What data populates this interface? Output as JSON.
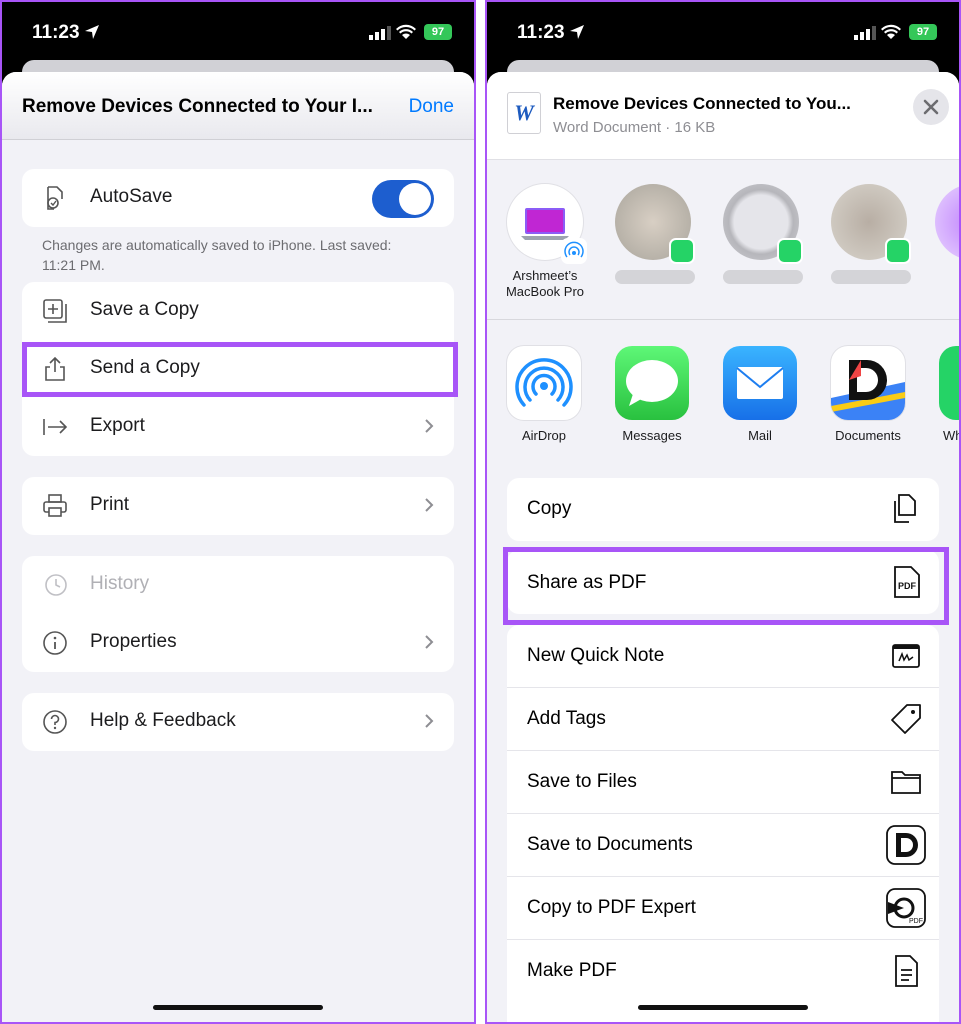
{
  "status": {
    "time": "11:23",
    "battery": "97"
  },
  "left": {
    "title": "Remove Devices Connected to Your I...",
    "done": "Done",
    "autosave": {
      "label": "AutoSave",
      "enabled": true,
      "note": "Changes are automatically saved to iPhone. Last saved: 11:21 PM."
    },
    "file_items": [
      {
        "label": "Save a Copy",
        "icon": "save-copy-icon"
      },
      {
        "label": "Send a Copy",
        "icon": "share-icon"
      },
      {
        "label": "Export",
        "icon": "export-arrow-icon"
      }
    ],
    "print": "Print",
    "history": "History",
    "properties": "Properties",
    "help": "Help & Feedback"
  },
  "right": {
    "doc_title": "Remove Devices Connected to You...",
    "doc_subtitle": "Word Document · 16 KB",
    "doc_icon_letter": "W",
    "airdrop_person": "Arshmeet’s MacBook Pro",
    "apps": [
      {
        "label": "AirDrop",
        "icon": "airdrop-icon"
      },
      {
        "label": "Messages",
        "icon": "messages-icon"
      },
      {
        "label": "Mail",
        "icon": "mail-icon"
      },
      {
        "label": "Documents",
        "icon": "documents-app-icon"
      },
      {
        "label": "Wh",
        "icon": "whatsapp-icon"
      }
    ],
    "actions": [
      {
        "label": "Copy",
        "icon": "copy-icon"
      },
      {
        "label": "Share as PDF",
        "icon": "pdf-icon"
      },
      {
        "label": "New Quick Note",
        "icon": "quick-note-icon"
      },
      {
        "label": "Add Tags",
        "icon": "tag-icon"
      },
      {
        "label": "Save to Files",
        "icon": "folder-icon"
      },
      {
        "label": "Save to Documents",
        "icon": "documents-icon"
      },
      {
        "label": "Copy to PDF Expert",
        "icon": "pdf-expert-icon"
      },
      {
        "label": "Make PDF",
        "icon": "document-icon"
      }
    ],
    "pdf_glyph": "PDF"
  },
  "colors": {
    "accent": "#007aff",
    "highlight": "#a855f7",
    "toggle": "#1d5ecf"
  }
}
